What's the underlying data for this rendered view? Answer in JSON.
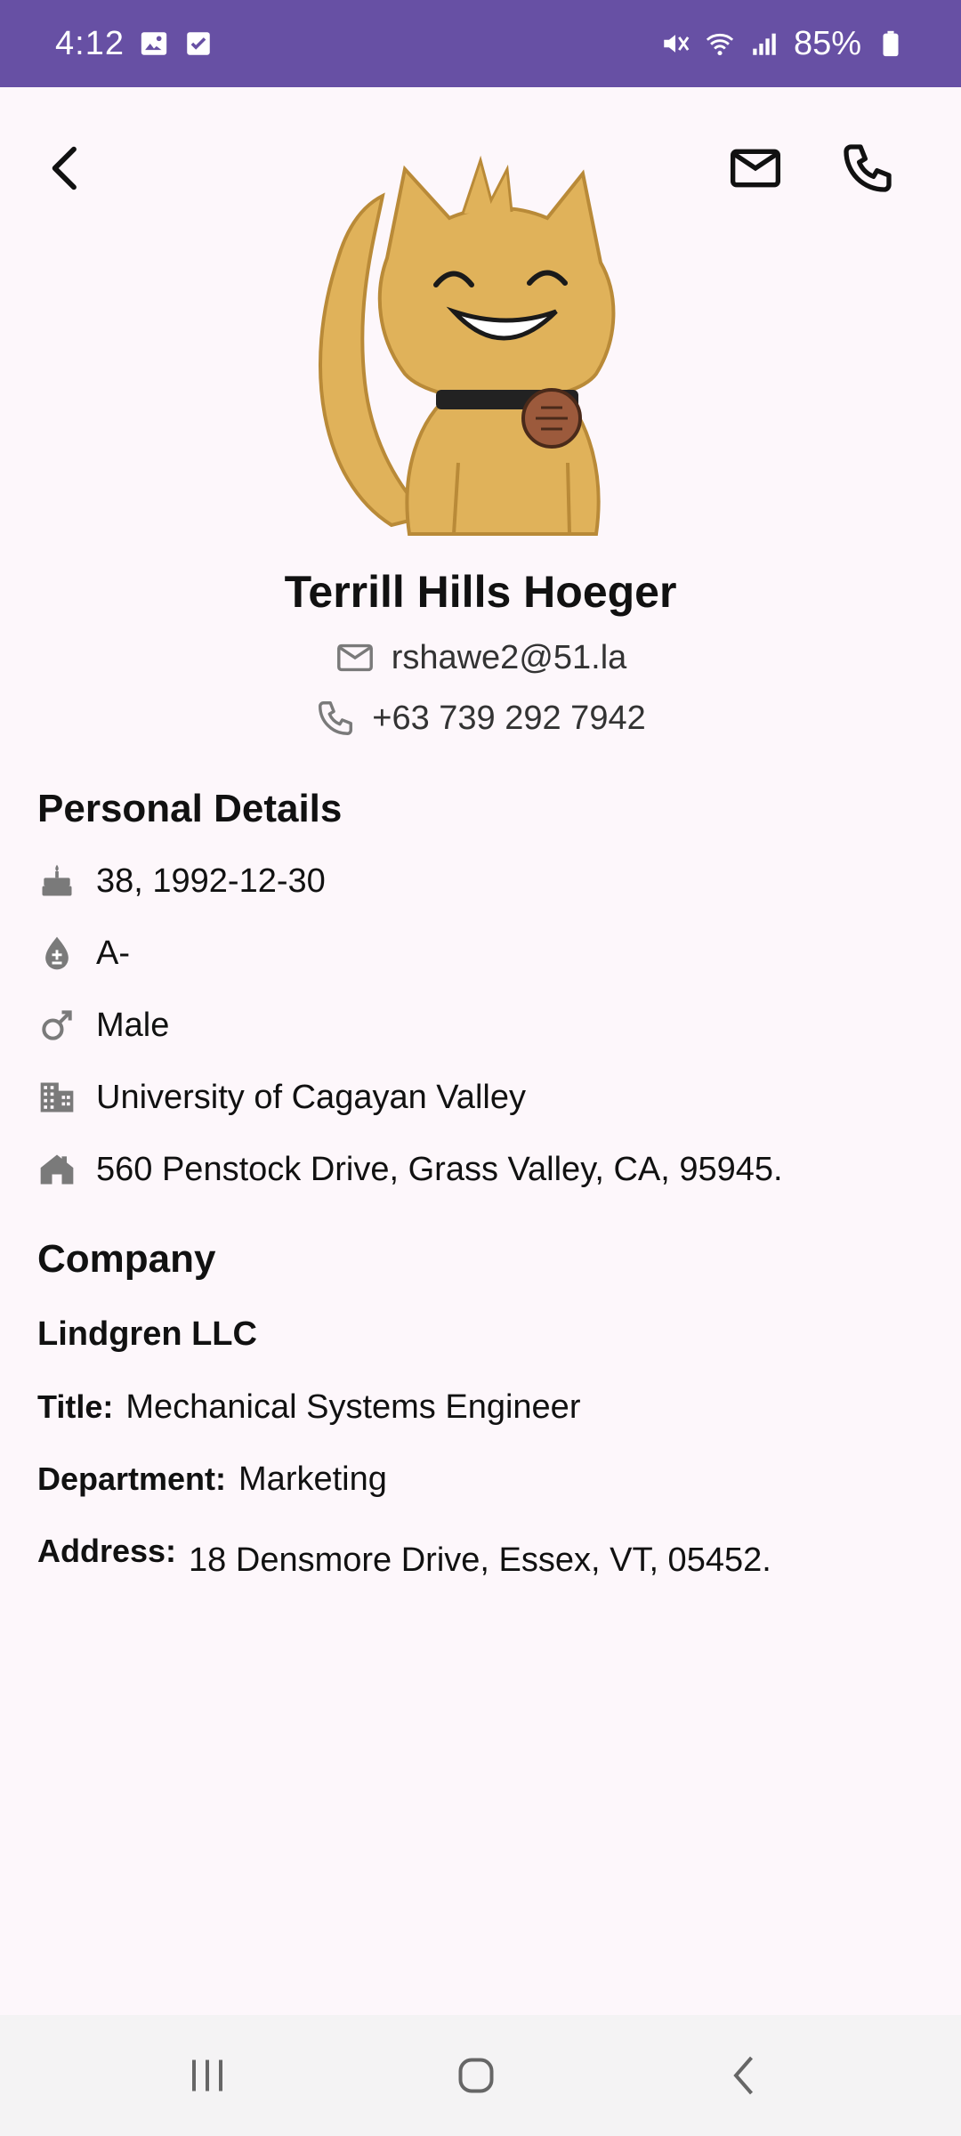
{
  "status_bar": {
    "time": "4:12",
    "battery": "85%",
    "icons": [
      "gallery-icon",
      "checkbox-icon",
      "mute-icon",
      "wifi-icon",
      "signal-icon",
      "battery-icon"
    ]
  },
  "top_bar": {
    "back_icon": "chevron-left-icon",
    "mail_icon": "mail-icon",
    "phone_icon": "phone-icon"
  },
  "profile": {
    "name": "Terrill Hills Hoeger",
    "email": "rshawe2@51.la",
    "phone": "+63 739 292 7942"
  },
  "personal": {
    "title": "Personal Details",
    "age_birthdate": "38, 1992-12-30",
    "blood_type": "A-",
    "gender": "Male",
    "university": "University of Cagayan Valley",
    "address": "560 Penstock Drive, Grass Valley, CA, 95945."
  },
  "company": {
    "section_title": "Company",
    "name": "Lindgren LLC",
    "title_label": "Title:",
    "title_value": "Mechanical Systems Engineer",
    "department_label": "Department:",
    "department_value": "Marketing",
    "address_label": "Address:",
    "address_value": "18 Densmore Drive, Essex, VT, 05452."
  },
  "colors": {
    "status_bar": "#6750a4",
    "background": "#fdf7fb",
    "icon_gray": "#7a7a7a",
    "cat_fur": "#e0b25a"
  }
}
